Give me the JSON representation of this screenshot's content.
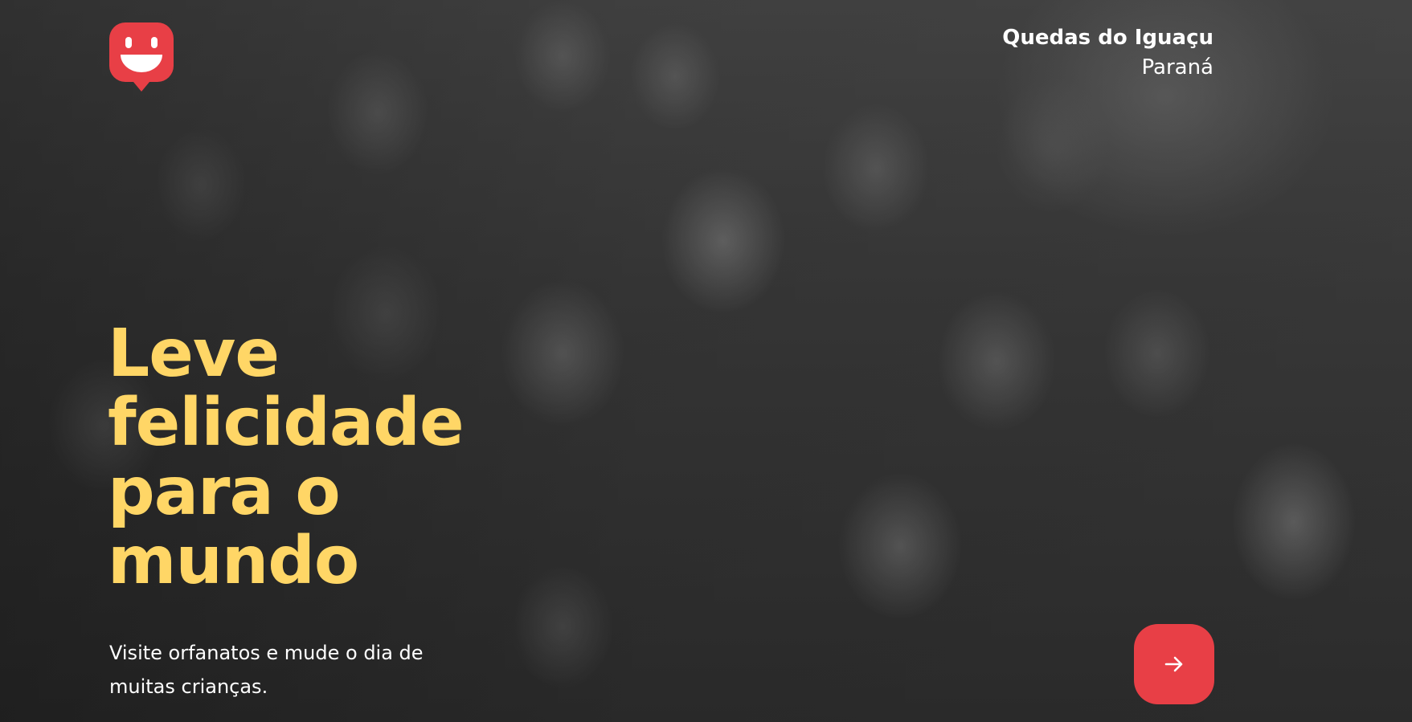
{
  "header": {
    "logo_icon": "smiley-chat-icon",
    "brand_color": "#E83F46",
    "location": {
      "city": "Quedas do Iguaçu",
      "state": "Paraná"
    }
  },
  "main": {
    "headline": "Leve felicidade para o mundo",
    "subtitle": "Visite orfanatos e mude o dia de muitas crianças.",
    "headline_color": "#FFD666",
    "cta": {
      "icon": "arrow-right-icon",
      "color": "#E83F46"
    }
  },
  "background": {
    "image": "grayscale photo of smiling children giving thumbs up"
  }
}
